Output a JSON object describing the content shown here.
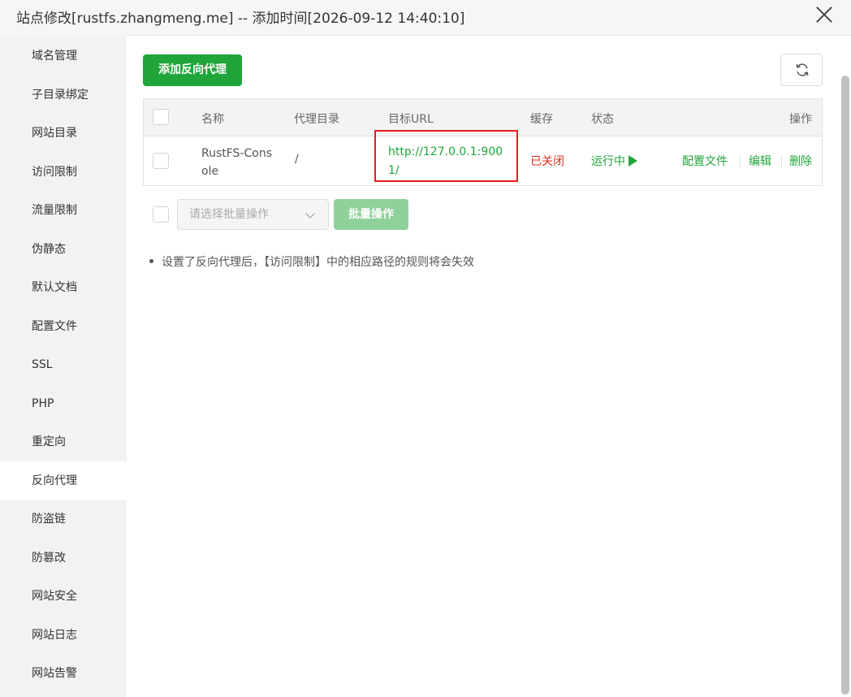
{
  "window": {
    "title": "站点修改[rustfs.zhangmeng.me] -- 添加时间[2026-09-12 14:40:10]"
  },
  "sidebar": {
    "items": [
      {
        "label": "域名管理"
      },
      {
        "label": "子目录绑定"
      },
      {
        "label": "网站目录"
      },
      {
        "label": "访问限制"
      },
      {
        "label": "流量限制"
      },
      {
        "label": "伪静态"
      },
      {
        "label": "默认文档"
      },
      {
        "label": "配置文件"
      },
      {
        "label": "SSL"
      },
      {
        "label": "PHP"
      },
      {
        "label": "重定向"
      },
      {
        "label": "反向代理"
      },
      {
        "label": "防盗链"
      },
      {
        "label": "防篡改"
      },
      {
        "label": "网站安全"
      },
      {
        "label": "网站日志"
      },
      {
        "label": "网站告警"
      }
    ],
    "active": "反向代理"
  },
  "toolbar": {
    "add_label": "添加反向代理",
    "refresh_icon": "refresh-icon"
  },
  "table": {
    "headers": {
      "name": "名称",
      "proxy_dir": "代理目录",
      "target_url": "目标URL",
      "cache": "缓存",
      "status": "状态",
      "actions": "操作"
    },
    "rows": [
      {
        "name_line1": "RustFS-Cons",
        "name_line2": "ole",
        "proxy_dir": "/",
        "url_line1": "http://127.0.0.1:900",
        "url_line2": "1/",
        "cache": "已关闭",
        "status": "运行中",
        "action_config": "配置文件",
        "action_edit": "编辑",
        "action_delete": "删除"
      }
    ]
  },
  "batch": {
    "placeholder": "请选择批量操作",
    "button_label": "批量操作"
  },
  "tips": [
    "设置了反向代理后，【访问限制】中的相应路径的规则将会失效"
  ],
  "colors": {
    "primary": "#20a53a",
    "danger": "#e0301e",
    "highlight_box": "#e02020"
  }
}
